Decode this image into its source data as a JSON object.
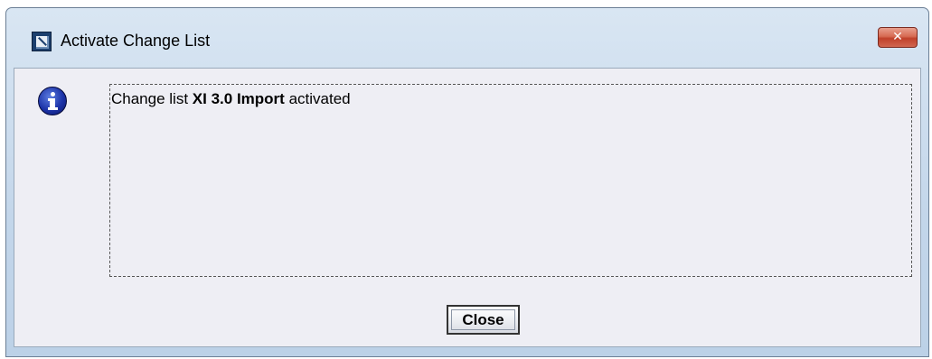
{
  "window": {
    "title": "Activate Change List",
    "close_glyph": "✕"
  },
  "message": {
    "prefix": "Change list",
    "change_list_name": "XI 3.0 Import",
    "suffix": "activated"
  },
  "buttons": {
    "close_label": "Close"
  },
  "icons": {
    "app": "app-window-icon",
    "info": "info-icon",
    "window_close": "close-icon"
  },
  "colors": {
    "client_background": "#eeeef4",
    "title_background": "#c3d6ea",
    "close_button_red": "#c0402a",
    "info_icon_blue": "#1c33a8"
  }
}
